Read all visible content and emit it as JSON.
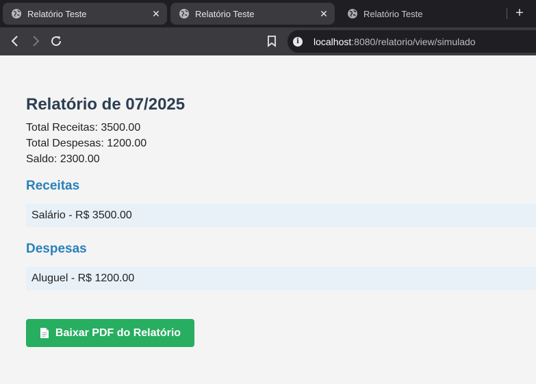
{
  "browser": {
    "tabs": [
      {
        "title": "Relatório Teste",
        "close": "✕"
      },
      {
        "title": "Relatório Teste",
        "close": "✕"
      },
      {
        "title": "Relatório Teste"
      }
    ],
    "new_tab": "+",
    "url_host": "localhost",
    "url_rest": ":8080/relatorio/view/simulado",
    "info_glyph": "i"
  },
  "report": {
    "title": "Relatório de 07/2025",
    "total_receitas": "Total Receitas: 3500.00",
    "total_despesas": "Total Despesas: 1200.00",
    "saldo": "Saldo: 2300.00",
    "receitas_heading": "Receitas",
    "receitas": [
      "Salário - R$ 3500.00"
    ],
    "despesas_heading": "Despesas",
    "despesas": [
      "Aluguel - R$ 1200.00"
    ],
    "download_button": "Baixar PDF do Relatório"
  },
  "colors": {
    "title": "#2c3e50",
    "section": "#2980b9",
    "entry_bg": "#e8f1f8",
    "button": "#27ae60"
  }
}
